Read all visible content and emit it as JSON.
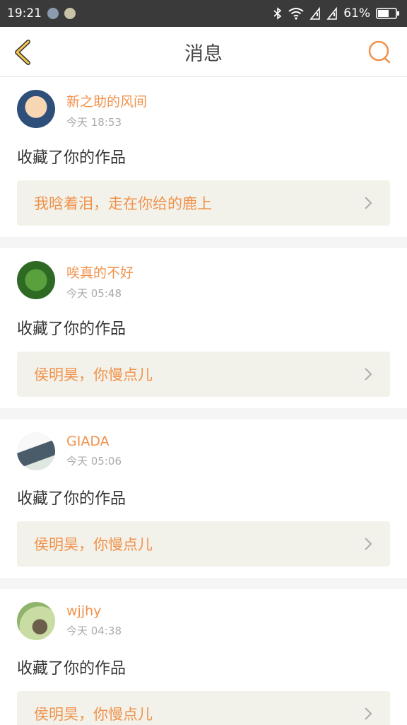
{
  "status_bar": {
    "time": "19:21",
    "battery": "61%"
  },
  "header": {
    "title": "消息"
  },
  "messages": [
    {
      "name": "新之助的风间",
      "time": "今天 18:53",
      "action": "收藏了你的作品",
      "work": "我晗着泪，走在你给的鹿上"
    },
    {
      "name": "唉真的不好",
      "time": "今天 05:48",
      "action": "收藏了你的作品",
      "work": "侯明昊，你慢点儿"
    },
    {
      "name": "GIADA",
      "time": "今天 05:06",
      "action": "收藏了你的作品",
      "work": "侯明昊，你慢点儿"
    },
    {
      "name": "wjjhy",
      "time": "今天 04:38",
      "action": "收藏了你的作品",
      "work": "侯明昊，你慢点儿"
    }
  ],
  "colors": {
    "accent": "#f0924c",
    "status_bg": "#3a3a3a",
    "quote_bg": "#f3f2ea"
  }
}
